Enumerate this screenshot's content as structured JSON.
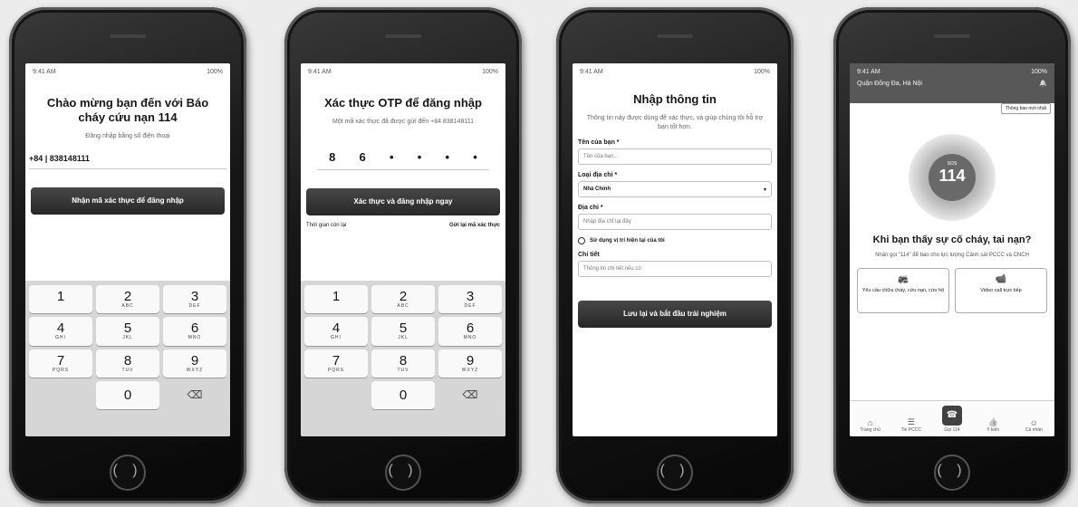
{
  "phone1": {
    "status_time": "9:41 AM",
    "status_right": "100%",
    "title": "Chào mừng bạn đến với Báo cháy cứu nạn 114",
    "subtitle": "Đăng nhập bằng số điện thoại",
    "phone_value": "+84 | 838148111",
    "button_label": "Nhận mã xác thực để đăng nhập",
    "keys": [
      {
        "d": "1",
        "l": ""
      },
      {
        "d": "2",
        "l": "ABC"
      },
      {
        "d": "3",
        "l": "DEF"
      },
      {
        "d": "4",
        "l": "GHI"
      },
      {
        "d": "5",
        "l": "JKL"
      },
      {
        "d": "6",
        "l": "MNO"
      },
      {
        "d": "7",
        "l": "PQRS"
      },
      {
        "d": "8",
        "l": "TUV"
      },
      {
        "d": "9",
        "l": "WXYZ"
      },
      {
        "d": "0",
        "l": ""
      }
    ]
  },
  "phone2": {
    "status_time": "9:41 AM",
    "status_right": "100%",
    "title": "Xác thực OTP để đăng nhập",
    "subtitle": "Một mã xác thực đã được gửi đến +84 838148111",
    "otp": [
      "8",
      "6",
      "•",
      "•",
      "•",
      "•"
    ],
    "button_label": "Xác thực và đăng nhập ngay",
    "link_left": "Thời gian còn lại",
    "link_right": "Gửi lại mã xác thực"
  },
  "phone3": {
    "status_time": "9:41 AM",
    "status_right": "100%",
    "title": "Nhập thông tin",
    "subtitle": "Thông tin này được dùng để xác thực, và giúp chúng tôi hỗ trợ bạn tốt hơn.",
    "name_label": "Tên của bạn *",
    "name_placeholder": "Tên của bạn...",
    "addr_type_label": "Loại địa chỉ *",
    "addr_type_value": "Nhà Chính",
    "addr_label": "Địa chỉ *",
    "addr_placeholder": "Nhập địa chỉ tại đây",
    "use_location": "Sử dụng vị trí hiện tại của tôi",
    "detail_label": "Chi tiết",
    "detail_placeholder": "Thông tin chi tiết nếu có",
    "button_label": "Lưu lại và bắt đầu trải nghiệm"
  },
  "phone4": {
    "status_time": "9:41 AM",
    "status_right": "100%",
    "location": "Quận Đống Đa, Hà Nội",
    "notif": "Thông báo mới nhất",
    "sos": "SOS",
    "number": "114",
    "question": "Khi bạn thấy sự cố cháy, tai nạn?",
    "hint": "Nhấn gọi \"114\" để báo cho lực lượng Cảnh sát PCCC và CNCH",
    "action1": "Yêu cầu chữa cháy, cứu nạn, cứu hộ",
    "action2": "Video call trực tiếp",
    "tabs": [
      "Trang chủ",
      "Tin PCCC",
      "Gọi 114",
      "Ý kiến",
      "Cá nhân"
    ]
  }
}
